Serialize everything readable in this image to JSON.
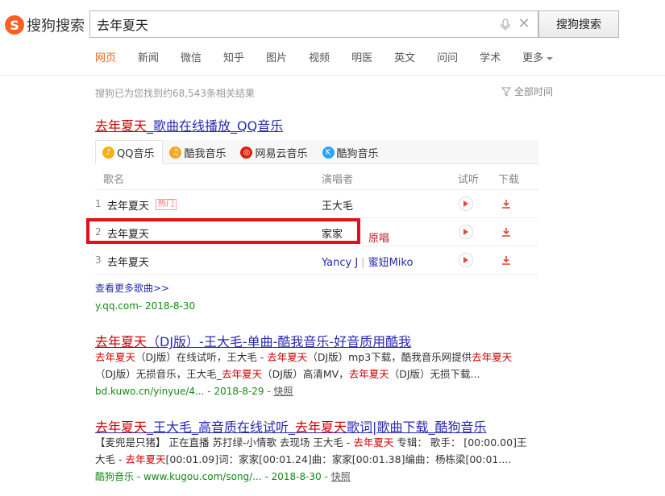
{
  "header": {
    "logo_text": "搜狗搜索",
    "query": "去年夏天",
    "search_button": "搜狗搜索"
  },
  "nav": [
    {
      "label": "网页",
      "active": true
    },
    {
      "label": "新闻"
    },
    {
      "label": "微信"
    },
    {
      "label": "知乎"
    },
    {
      "label": "图片"
    },
    {
      "label": "视频"
    },
    {
      "label": "明医"
    },
    {
      "label": "英文"
    },
    {
      "label": "问问"
    },
    {
      "label": "学术"
    },
    {
      "label": "更多"
    }
  ],
  "result_count": "搜狗已为您找到约68,543条相关结果",
  "time_filter": "全部时间",
  "result1": {
    "title_hl": "去年夏天",
    "title_rest": "_歌曲在线播放_QQ音乐",
    "tabs": [
      "QQ音乐",
      "酷我音乐",
      "网易云音乐",
      "酷狗音乐"
    ],
    "columns": {
      "song": "歌名",
      "singer": "演唱者",
      "listen": "试听",
      "download": "下载"
    },
    "rows": [
      {
        "idx": "1",
        "song": "去年夏天",
        "badge": "热门",
        "singer": "王大毛"
      },
      {
        "idx": "2",
        "song": "去年夏天",
        "singer": "家家"
      },
      {
        "idx": "3",
        "song": "去年夏天",
        "singer_a": "Yancy J",
        "singer_b": "蜜妞Miko"
      }
    ],
    "note": "原唱",
    "more": "查看更多歌曲>>",
    "url": "y.qq.com- 2018-8-30"
  },
  "result2": {
    "title_hl": "去年夏天",
    "title_rest": "（DJ版）-王大毛-单曲-酷我音乐-好音质用酷我",
    "desc_1a": "去年夏天",
    "desc_1b": "（DJ版）在线试听，王大毛 - ",
    "desc_1c": "去年夏天",
    "desc_1d": "（DJ版）mp3下载，酷我音乐网提供",
    "desc_1e": "去年夏天",
    "desc_2a": "（DJ版）无损音乐，王大毛_",
    "desc_2b": "去年夏天",
    "desc_2c": "（DJ版）高清MV，",
    "desc_2d": "去年夏天",
    "desc_2e": "（DJ版）无损下载...",
    "url": "bd.kuwo.cn/yinyue/4... - 2018-8-29 - ",
    "snapshot": "快照"
  },
  "result3": {
    "title_a": "去年夏天",
    "title_b": "_王大毛_高音质在线试听_",
    "title_c": "去年夏天",
    "title_d": "歌词|歌曲下载_酷狗音乐",
    "desc_1a": "【麦兜是只猪】 正在直播 苏打绿-小情歌 去现场 王大毛 - ",
    "desc_1b": "去年夏天",
    "desc_1c": " 专辑： 歌手： [00:00.00]王",
    "desc_2a": "大毛 - ",
    "desc_2b": "去年夏天",
    "desc_2c": "[00:01.09]词：家家[00:01.24]曲：家家[00:01.38]编曲：杨栋梁[00:01....",
    "url": "酷狗音乐 - www.kugou.com/song/... - 2018-8-30 - ",
    "snapshot": "快照"
  },
  "colors": {
    "brand": "#fb6022",
    "link": "#2a2ab0",
    "highlight": "#cc0000",
    "url": "#168a16",
    "annotation": "#e3101a"
  }
}
